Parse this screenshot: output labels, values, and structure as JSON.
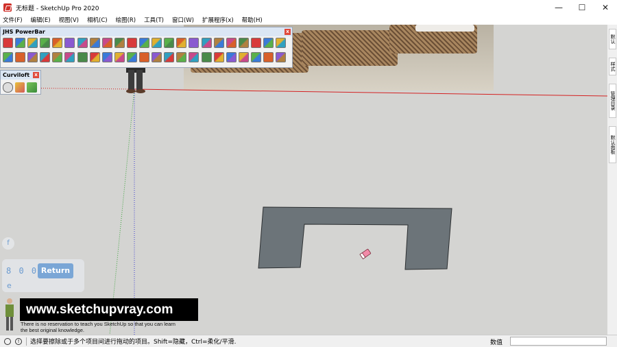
{
  "window": {
    "title": "无标题 - SketchUp Pro 2020",
    "controls": {
      "minimize": "—",
      "maximize": "☐",
      "close": "✕"
    }
  },
  "menu": [
    "文件(F)",
    "编辑(E)",
    "视图(V)",
    "相机(C)",
    "绘图(R)",
    "工具(T)",
    "窗口(W)",
    "扩展程序(x)",
    "帮助(H)"
  ],
  "toolbars": {
    "powerbar": {
      "title": "JHS PowerBar",
      "close": "x"
    },
    "curviloft": {
      "title": "Curviloft",
      "close": "x"
    }
  },
  "tray_tabs": [
    "默认",
    "样式",
    "管理目录",
    "默认面板"
  ],
  "vcb_overlay": {
    "top_label": "f",
    "digits": "8 0 0",
    "return_label": "Return",
    "bottom_label": "e"
  },
  "banner": {
    "url": "www.sketchupvray.com",
    "caption_line1": "There is no reservation to teach you SketchUp so that you can learn",
    "caption_line2": "the best original knowledge."
  },
  "status": {
    "hint": "选择要擦除或于多个项目间进行拖动的项目。Shift=隐藏，Ctrl=柔化/平滑.",
    "measure_label": "数值",
    "measure_value": ""
  },
  "colors": {
    "canvas": "#d4d4d2",
    "shape_fill": "#6c7479",
    "red_axis": "#d42020",
    "green_axis": "#3aa33a",
    "blue_axis": "#3b3bd0"
  }
}
